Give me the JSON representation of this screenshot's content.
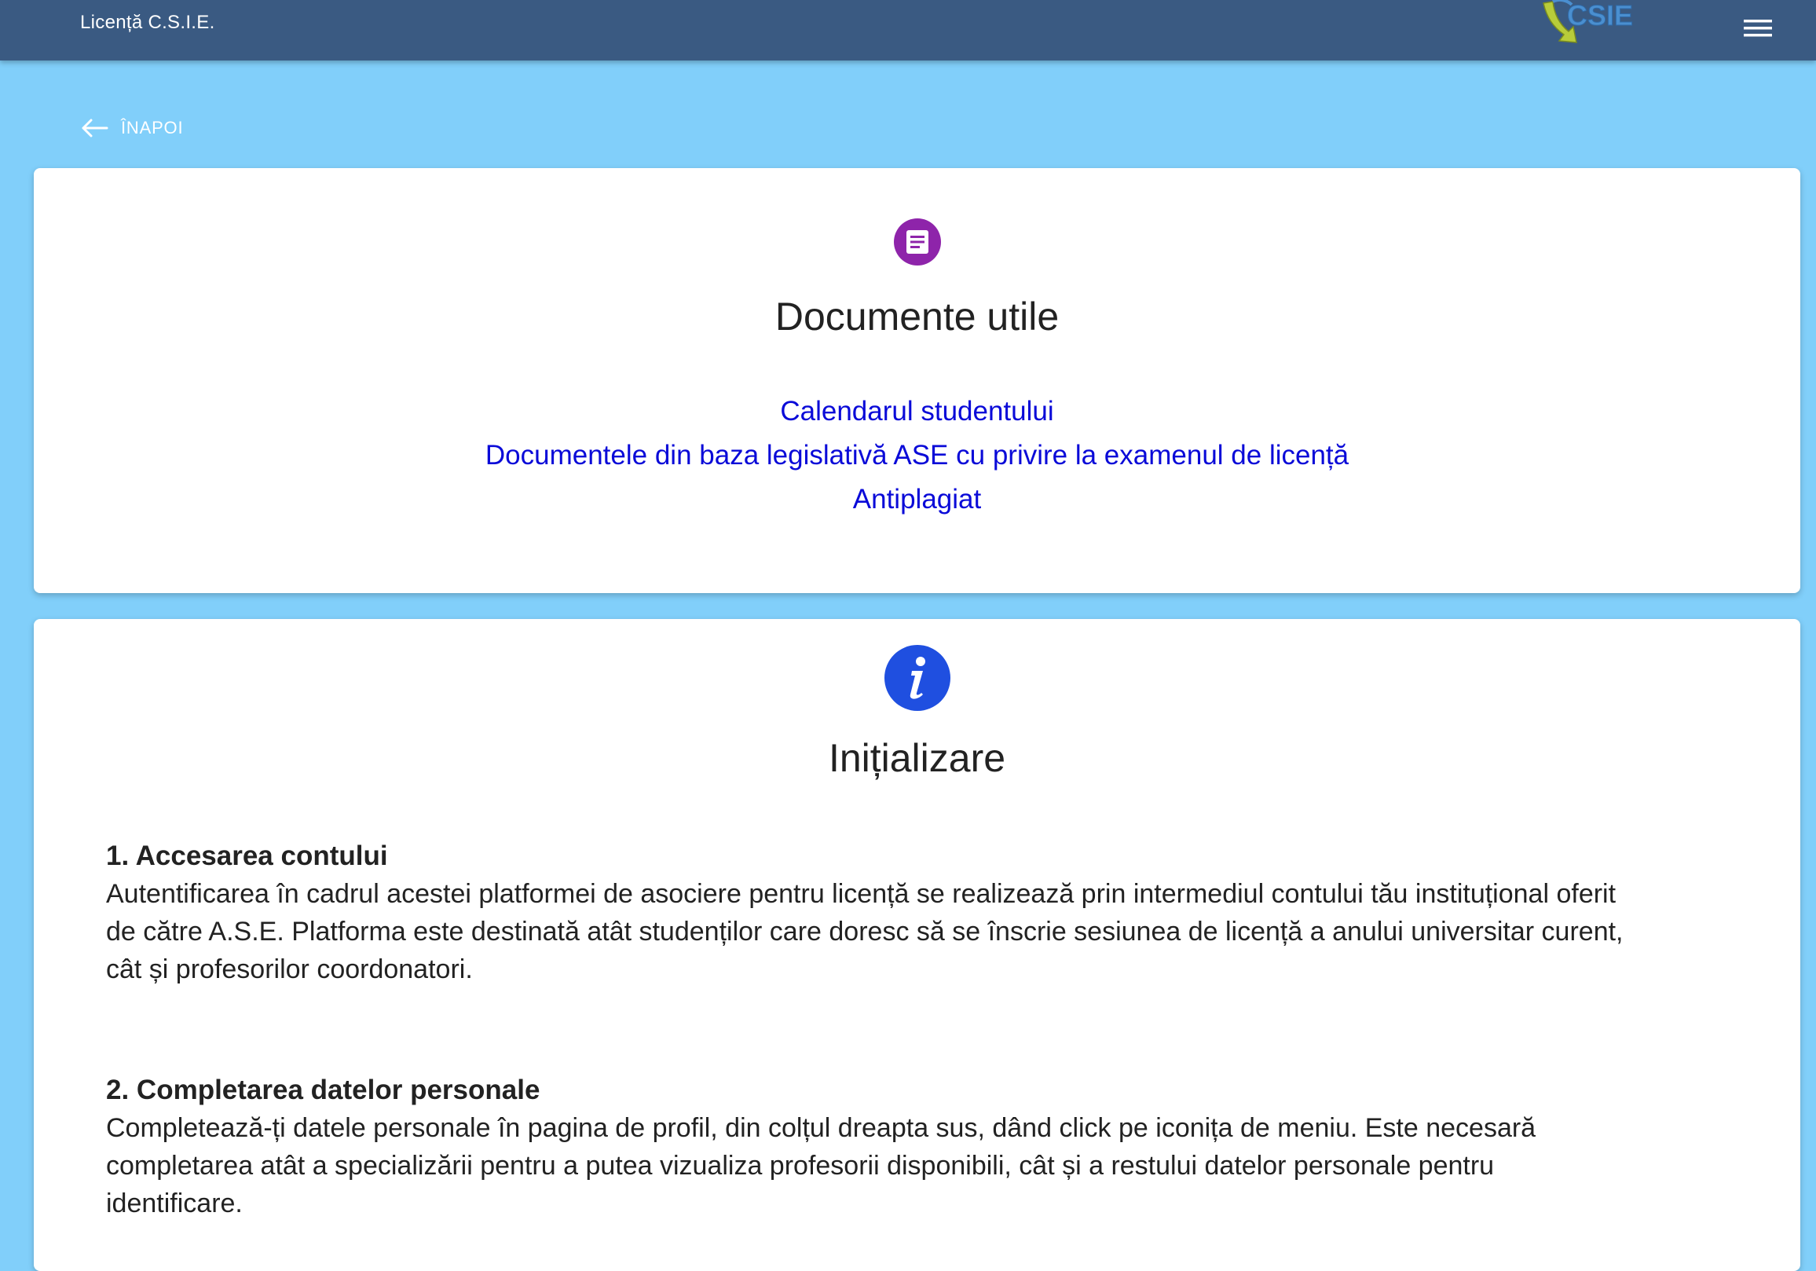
{
  "header": {
    "title": "Licență C.S.I.E.",
    "logo_text": "CSIE",
    "menu_icon": "hamburger-menu-icon"
  },
  "nav": {
    "back_label": "ÎNAPOI",
    "back_icon": "arrow-left-icon"
  },
  "documents_card": {
    "icon": "document-icon",
    "icon_color": "#8e24aa",
    "title": "Documente utile",
    "links": [
      "Calendarul studentului",
      "Documentele din baza legislativă ASE cu privire la examenul de licență",
      "Antiplagiat"
    ]
  },
  "init_card": {
    "icon": "info-icon",
    "icon_color": "#1f4fe0",
    "title": "Inițializare",
    "sections": [
      {
        "heading": "1. Accesarea contului",
        "lines": [
          "Autentificarea în cadrul acestei platformei de asociere pentru licență se realizează prin intermediul contului tău instituțional oferit",
          "de către A.S.E. Platforma este destinată atât studenților care doresc să se înscrie sesiunea de licență a anului universitar curent,",
          "cât și profesorilor coordonatori."
        ]
      },
      {
        "heading": "2. Completarea datelor personale",
        "lines": [
          "Completează-ți datele personale în pagina de profil, din colțul dreapta sus, dând click pe iconița de meniu. Este necesară",
          "completarea atât a specializării pentru a putea vizualiza profesorii disponibili, cât și a restului datelor personale pentru",
          "identificare."
        ]
      }
    ]
  },
  "colors": {
    "background": "#81cffa",
    "topbar": "#3a5a82",
    "link": "#0a0ad8"
  }
}
